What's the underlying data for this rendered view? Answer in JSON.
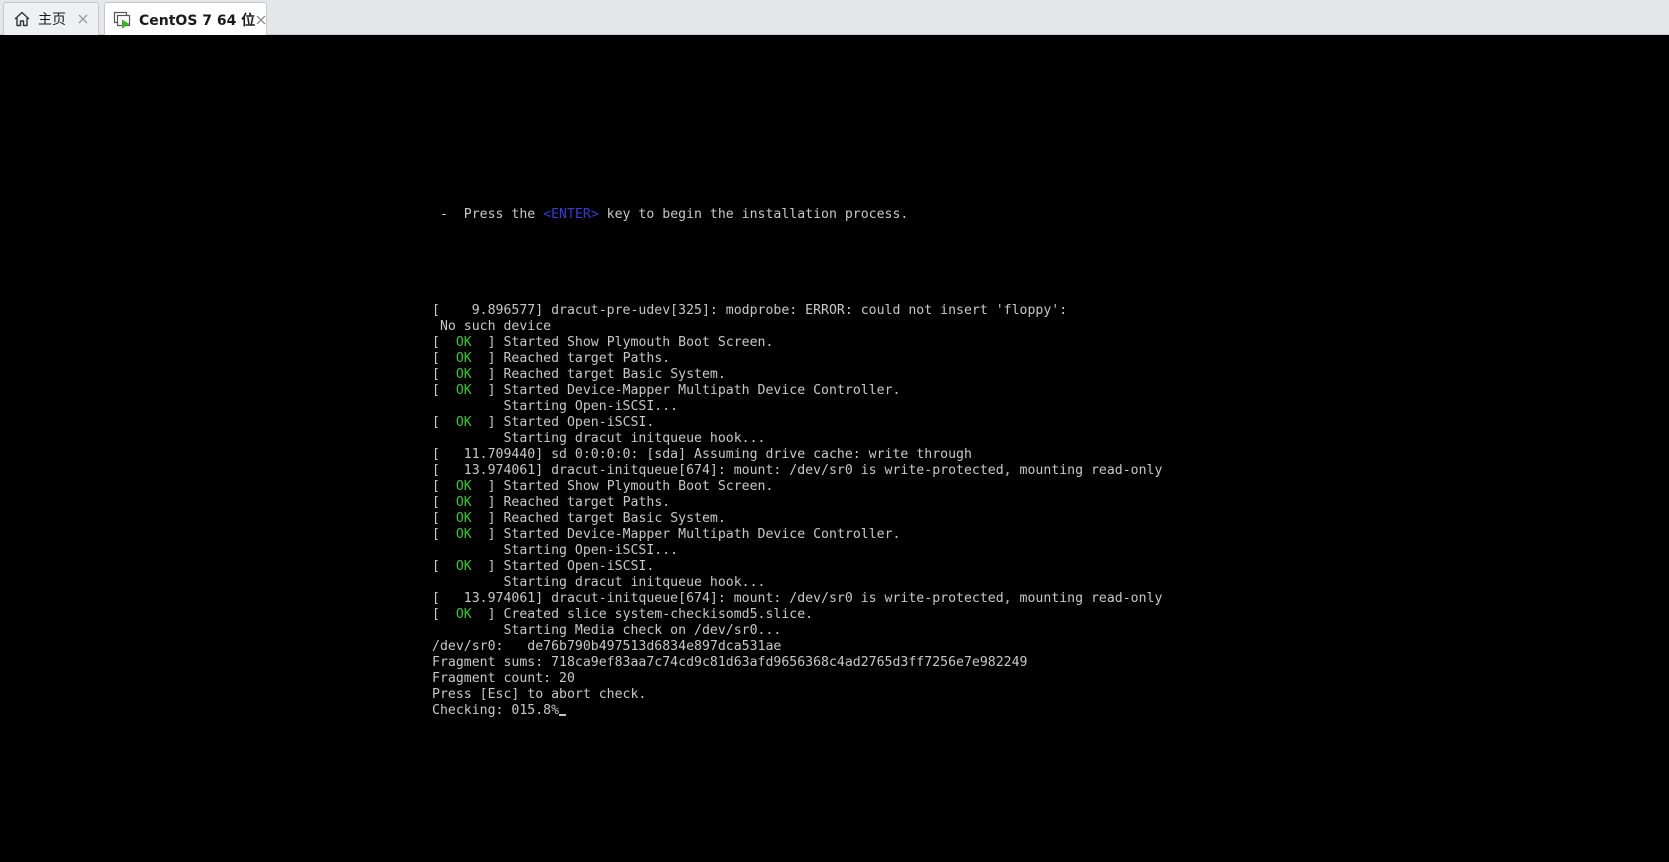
{
  "tabs": [
    {
      "label": "主页",
      "icon": "home-icon",
      "active": false
    },
    {
      "label": "CentOS 7 64 位",
      "icon": "vm-icon",
      "active": true
    }
  ],
  "colors": {
    "console_bg": "#000000",
    "console_text": "#c8c8c8",
    "ok": "#2ecc2e",
    "enter_key": "#3a3ad6"
  },
  "console": {
    "press_enter": {
      "before": " -  Press the ",
      "key": "<ENTER>",
      "after": " key to begin the installation process."
    },
    "lines": [
      {
        "pre": "[    9.896577] dracut-pre-udev[325]: modprobe: ERROR: could not insert 'floppy':",
        "ok": "",
        "post": ""
      },
      {
        "pre": " No such device",
        "ok": "",
        "post": ""
      },
      {
        "pre": "[  ",
        "ok": "OK",
        "post": "  ] Started Show Plymouth Boot Screen."
      },
      {
        "pre": "[  ",
        "ok": "OK",
        "post": "  ] Reached target Paths."
      },
      {
        "pre": "[  ",
        "ok": "OK",
        "post": "  ] Reached target Basic System."
      },
      {
        "pre": "[  ",
        "ok": "OK",
        "post": "  ] Started Device-Mapper Multipath Device Controller."
      },
      {
        "pre": "         Starting Open-iSCSI...",
        "ok": "",
        "post": ""
      },
      {
        "pre": "[  ",
        "ok": "OK",
        "post": "  ] Started Open-iSCSI."
      },
      {
        "pre": "         Starting dracut initqueue hook...",
        "ok": "",
        "post": ""
      },
      {
        "pre": "[   11.709440] sd 0:0:0:0: [sda] Assuming drive cache: write through",
        "ok": "",
        "post": ""
      },
      {
        "pre": "[   13.974061] dracut-initqueue[674]: mount: /dev/sr0 is write-protected, mounting read-only",
        "ok": "",
        "post": ""
      },
      {
        "pre": "[  ",
        "ok": "OK",
        "post": "  ] Started Show Plymouth Boot Screen."
      },
      {
        "pre": "[  ",
        "ok": "OK",
        "post": "  ] Reached target Paths."
      },
      {
        "pre": "[  ",
        "ok": "OK",
        "post": "  ] Reached target Basic System."
      },
      {
        "pre": "[  ",
        "ok": "OK",
        "post": "  ] Started Device-Mapper Multipath Device Controller."
      },
      {
        "pre": "         Starting Open-iSCSI...",
        "ok": "",
        "post": ""
      },
      {
        "pre": "[  ",
        "ok": "OK",
        "post": "  ] Started Open-iSCSI."
      },
      {
        "pre": "         Starting dracut initqueue hook...",
        "ok": "",
        "post": ""
      },
      {
        "pre": "[   13.974061] dracut-initqueue[674]: mount: /dev/sr0 is write-protected, mounting read-only",
        "ok": "",
        "post": ""
      },
      {
        "pre": "[  ",
        "ok": "OK",
        "post": "  ] Created slice system-checkisomd5.slice."
      },
      {
        "pre": "         Starting Media check on /dev/sr0...",
        "ok": "",
        "post": ""
      },
      {
        "pre": "/dev/sr0:   de76b790b497513d6834e897dca531ae",
        "ok": "",
        "post": ""
      },
      {
        "pre": "Fragment sums: 718ca9ef83aa7c74cd9c81d63afd9656368c4ad2765d3ff7256e7e982249",
        "ok": "",
        "post": ""
      },
      {
        "pre": "Fragment count: 20",
        "ok": "",
        "post": ""
      },
      {
        "pre": "Press [Esc] to abort check.",
        "ok": "",
        "post": ""
      },
      {
        "pre": "Checking: 015.8%",
        "ok": "",
        "post": ""
      }
    ]
  }
}
